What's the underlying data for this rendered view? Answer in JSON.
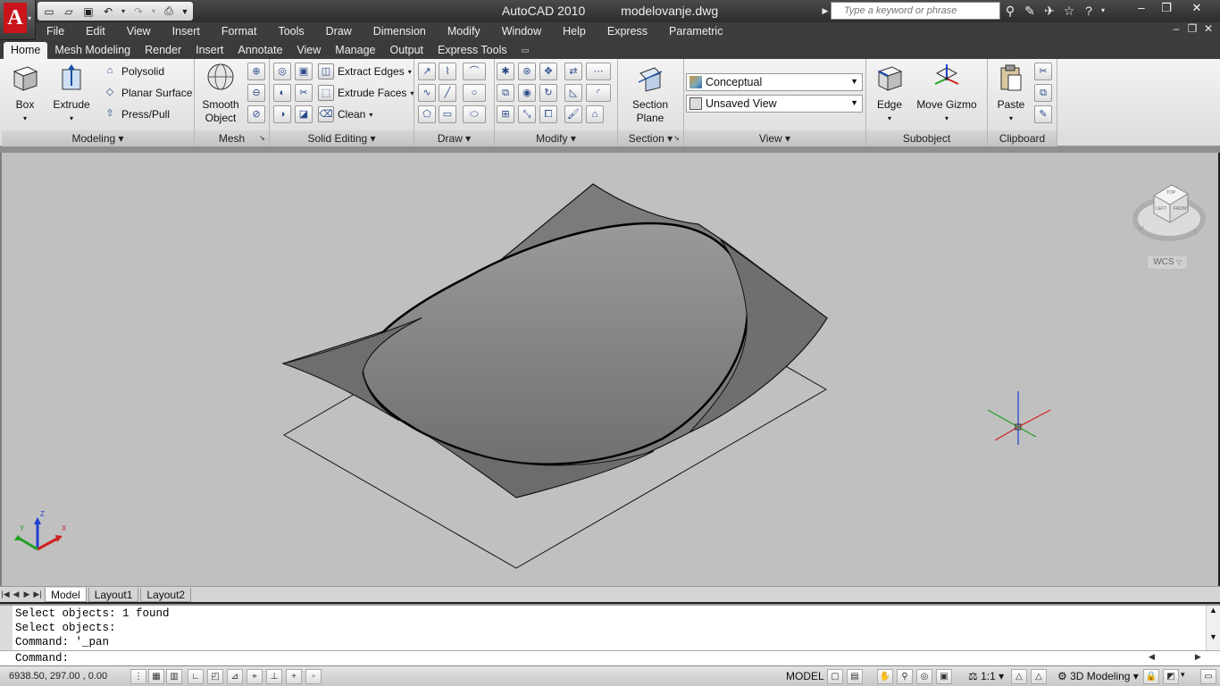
{
  "title": {
    "app": "AutoCAD 2010",
    "file": "modelovanje.dwg"
  },
  "search": {
    "placeholder": "Type a keyword or phrase"
  },
  "menu": [
    "File",
    "Edit",
    "View",
    "Insert",
    "Format",
    "Tools",
    "Draw",
    "Dimension",
    "Modify",
    "Window",
    "Help",
    "Express",
    "Parametric"
  ],
  "ribbon_tabs": [
    "Home",
    "Mesh Modeling",
    "Render",
    "Insert",
    "Annotate",
    "View",
    "Manage",
    "Output",
    "Express Tools"
  ],
  "active_ribbon_tab": "Home",
  "panels": {
    "modeling": {
      "title": "Modeling",
      "box": "Box",
      "extrude": "Extrude",
      "polysolid": "Polysolid",
      "planar_surface": "Planar Surface",
      "press_pull": "Press/Pull"
    },
    "mesh": {
      "title": "Mesh",
      "smooth_object_1": "Smooth",
      "smooth_object_2": "Object"
    },
    "solid_editing": {
      "title": "Solid Editing",
      "extract_edges": "Extract Edges",
      "extrude_faces": "Extrude Faces",
      "clean": "Clean"
    },
    "draw": {
      "title": "Draw"
    },
    "modify": {
      "title": "Modify"
    },
    "section": {
      "title": "Section",
      "section_plane_1": "Section",
      "section_plane_2": "Plane"
    },
    "view": {
      "title": "View",
      "visual_style": "Conceptual",
      "named_view": "Unsaved View"
    },
    "subobject": {
      "title": "Subobject",
      "edge": "Edge",
      "move_gizmo": "Move Gizmo"
    },
    "clipboard": {
      "title": "Clipboard",
      "paste": "Paste"
    }
  },
  "viewcube": {
    "top": "TOP",
    "left": "LEFT",
    "front": "FRONT",
    "compass_w": "W",
    "compass_s": "S",
    "wcs": "WCS"
  },
  "ucs": {
    "x": "X",
    "y": "Y",
    "z": "Z"
  },
  "layout_tabs": [
    "Model",
    "Layout1",
    "Layout2"
  ],
  "active_layout_tab": "Model",
  "command_history": [
    "Select objects: 1 found",
    "Select objects:",
    "Command: '_pan"
  ],
  "command_prompt": "Command:",
  "status": {
    "coords": "6938.50, 297.00 , 0.00",
    "model": "MODEL",
    "annotation_scale": "1:1",
    "workspace": "3D Modeling"
  },
  "colors": {
    "viewport_bg": "#c0c0c0",
    "surface_fill": "#7a7a7a",
    "ucs_x": "#d02020",
    "ucs_y": "#20a020",
    "ucs_z": "#2040d0"
  }
}
